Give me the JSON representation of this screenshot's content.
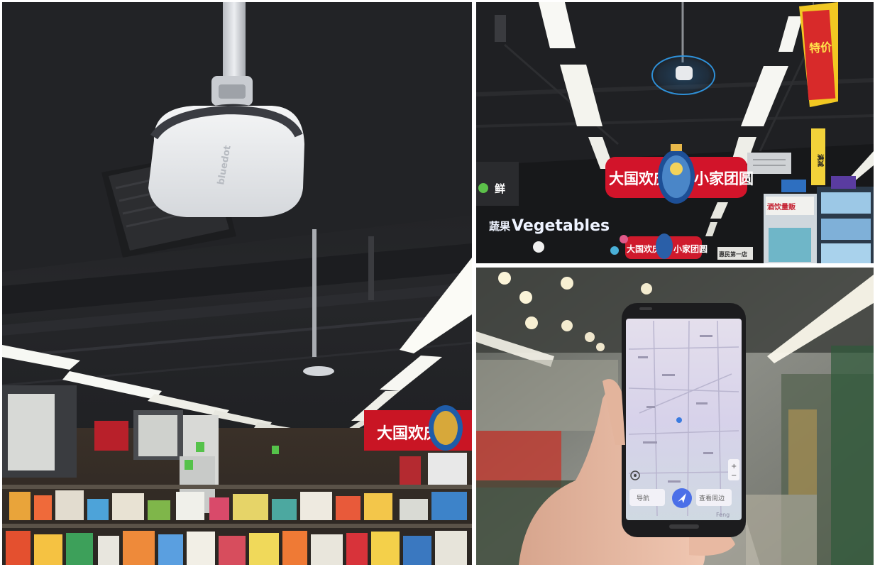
{
  "photos": [
    {
      "id": "ceiling-beacon-photo",
      "signs": {
        "banner": "大国欢庆",
        "device_brand": "bluedot"
      }
    },
    {
      "id": "supermarket-ceiling-photo",
      "signs": {
        "banner_left": "大国欢庆",
        "banner_right": "小家团圆",
        "banner2_left": "大国欢庆",
        "banner2_right": "小家团圆",
        "vegetables": "Vegetables",
        "vegetables_prefix": "蔬果",
        "fresh": "鲜",
        "shelf_sign": "酒饮量贩",
        "hanging_sign": "特价",
        "side_sign": "满减",
        "small_sign": "惠民第一店"
      }
    },
    {
      "id": "phone-map-photo",
      "phone": {
        "nav_left": "导航",
        "nav_right": "查看周边",
        "watermark": "Feng"
      }
    }
  ],
  "colors": {
    "banner_red": "#d2142a",
    "map_bg": "#dcd8ec",
    "beacon_white": "#e9ebee",
    "location_blue": "#3a7be0"
  }
}
